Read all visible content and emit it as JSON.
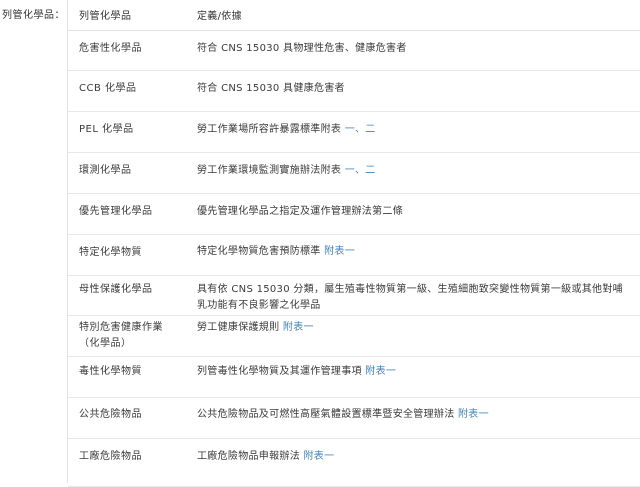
{
  "field_label": "列管化學品：",
  "table": {
    "headers": {
      "category": "列管化學品",
      "definition": "定義/依據"
    },
    "rows": [
      {
        "category": "危害性化學品",
        "definition": "符合 CNS 15030 具物理性危害、健康危害者",
        "link": ""
      },
      {
        "category": "CCB 化學品",
        "definition": "符合 CNS 15030 具健康危害者",
        "link": ""
      },
      {
        "category": "PEL 化學品",
        "definition": "勞工作業場所容許暴露標準附表 ",
        "link": "一、二"
      },
      {
        "category": "環測化學品",
        "definition": "勞工作業環境監測實施辦法附表 ",
        "link": "一、二"
      },
      {
        "category": "優先管理化學品",
        "definition": "優先管理化學品之指定及運作管理辦法第二條",
        "link": ""
      },
      {
        "category": "特定化學物質",
        "definition": "特定化學物質危害預防標準 ",
        "link": "附表一"
      },
      {
        "category": "母性保護化學品",
        "definition": "具有依 CNS 15030 分類，屬生殖毒性物質第一級、生殖細胞致突變性物質第一級或其他對哺乳功能有不良影響之化學品",
        "link": ""
      },
      {
        "category": "特別危害健康作業（化學品）",
        "definition": "勞工健康保護規則 ",
        "link": "附表一"
      },
      {
        "category": "毒性化學物質",
        "definition": "列管毒性化學物質及其運作管理事項 ",
        "link": "附表一"
      },
      {
        "category": "公共危險物品",
        "definition": "公共危險物品及可燃性高壓氣體設置標準暨安全管理辦法 ",
        "link": "附表一"
      },
      {
        "category": "工廠危險物品",
        "definition": "工廠危險物品申報辦法 ",
        "link": "附表一"
      }
    ]
  },
  "colors": {
    "link": "#3f83bd",
    "text": "#3a3a3a",
    "border": "#e8e8e8"
  }
}
